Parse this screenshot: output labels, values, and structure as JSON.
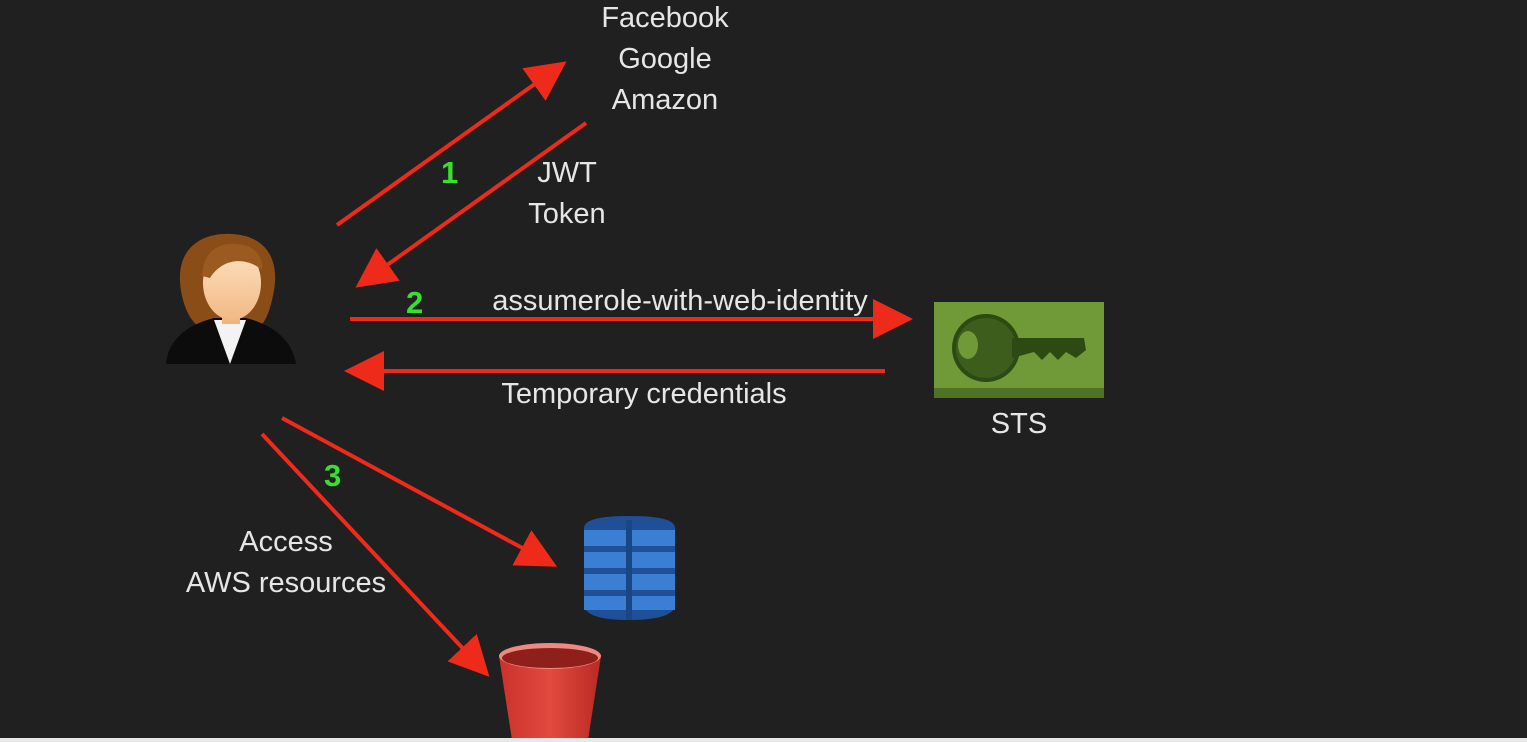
{
  "providers": [
    "Facebook",
    "Google",
    "Amazon"
  ],
  "jwt_label": [
    "JWT",
    "Token"
  ],
  "steps": [
    "1",
    "2",
    "3"
  ],
  "assume_role_label": "assumerole-with-web-identity",
  "temp_credentials_label": "Temporary credentials",
  "sts_label": "STS",
  "access_label": [
    "Access",
    "AWS resources"
  ],
  "colors": {
    "background": "#202020",
    "arrow": "#ee2a1a",
    "step_number": "#39e02e",
    "text": "#e6e6e6",
    "sts_green": "#6f9a37",
    "dynamodb_blue": "#2d6fc0",
    "s3_red": "#e0443a",
    "user_hair": "#8a4d18"
  },
  "icons": {
    "user": "user-avatar-icon",
    "sts": "key-icon",
    "dynamodb": "dynamodb-icon",
    "s3": "s3-bucket-icon"
  }
}
